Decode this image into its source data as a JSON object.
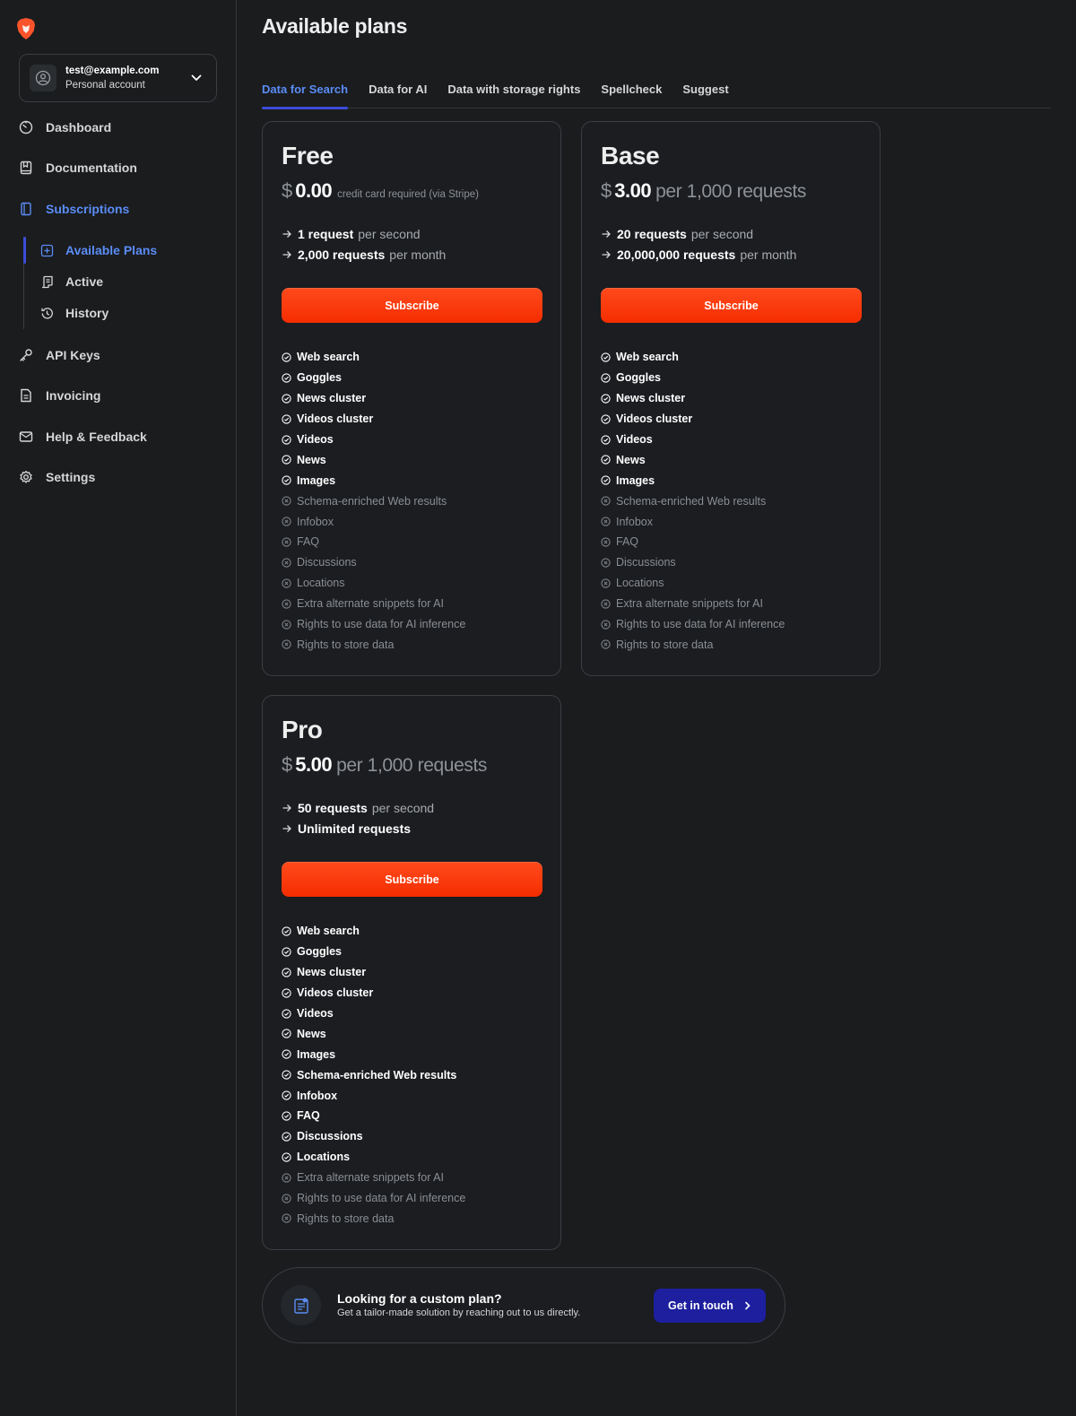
{
  "brand": {
    "wordmark": "",
    "accent": "#5b8cf5",
    "primary": "#f52d00",
    "cta": "#1d1f9e"
  },
  "account": {
    "email": "test@example.com",
    "type": "Personal account"
  },
  "nav": {
    "dashboard": "Dashboard",
    "documentation": "Documentation",
    "subscriptions": "Subscriptions",
    "available_plans": "Available Plans",
    "active": "Active",
    "history": "History",
    "api_keys": "API Keys",
    "invoicing": "Invoicing",
    "help": "Help & Feedback",
    "settings": "Settings"
  },
  "page": {
    "title": "Available plans"
  },
  "tabs": [
    "Data for Search",
    "Data for AI",
    "Data with storage rights",
    "Spellcheck",
    "Suggest"
  ],
  "plans": [
    {
      "name": "Free",
      "currency": "$",
      "amount": "0.00",
      "suffix": "credit card required (via Stripe)",
      "limit1_value": "1 request",
      "limit1_unit": "per second",
      "limit2_value": "2,000 requests",
      "limit2_unit": "per month",
      "button": "Subscribe",
      "features": [
        {
          "label": "Web search",
          "included": true
        },
        {
          "label": "Goggles",
          "included": true
        },
        {
          "label": "News cluster",
          "included": true
        },
        {
          "label": "Videos cluster",
          "included": true
        },
        {
          "label": "Videos",
          "included": true
        },
        {
          "label": "News",
          "included": true
        },
        {
          "label": "Images",
          "included": true
        },
        {
          "label": "Schema-enriched Web results",
          "included": false
        },
        {
          "label": "Infobox",
          "included": false
        },
        {
          "label": "FAQ",
          "included": false
        },
        {
          "label": "Discussions",
          "included": false
        },
        {
          "label": "Locations",
          "included": false
        },
        {
          "label": "Extra alternate snippets for AI",
          "included": false
        },
        {
          "label": "Rights to use data for AI inference",
          "included": false
        },
        {
          "label": "Rights to store data",
          "included": false
        }
      ]
    },
    {
      "name": "Base",
      "currency": "$",
      "amount": "3.00",
      "suffix": "per 1,000 requests",
      "limit1_value": "20 requests",
      "limit1_unit": "per second",
      "limit2_value": "20,000,000 requests",
      "limit2_unit": "per month",
      "button": "Subscribe",
      "features": [
        {
          "label": "Web search",
          "included": true
        },
        {
          "label": "Goggles",
          "included": true
        },
        {
          "label": "News cluster",
          "included": true
        },
        {
          "label": "Videos cluster",
          "included": true
        },
        {
          "label": "Videos",
          "included": true
        },
        {
          "label": "News",
          "included": true
        },
        {
          "label": "Images",
          "included": true
        },
        {
          "label": "Schema-enriched Web results",
          "included": false
        },
        {
          "label": "Infobox",
          "included": false
        },
        {
          "label": "FAQ",
          "included": false
        },
        {
          "label": "Discussions",
          "included": false
        },
        {
          "label": "Locations",
          "included": false
        },
        {
          "label": "Extra alternate snippets for AI",
          "included": false
        },
        {
          "label": "Rights to use data for AI inference",
          "included": false
        },
        {
          "label": "Rights to store data",
          "included": false
        }
      ]
    },
    {
      "name": "Pro",
      "currency": "$",
      "amount": "5.00",
      "suffix": "per 1,000 requests",
      "limit1_value": "50 requests",
      "limit1_unit": "per second",
      "limit2_value": "Unlimited requests",
      "limit2_unit": "",
      "button": "Subscribe",
      "features": [
        {
          "label": "Web search",
          "included": true
        },
        {
          "label": "Goggles",
          "included": true
        },
        {
          "label": "News cluster",
          "included": true
        },
        {
          "label": "Videos cluster",
          "included": true
        },
        {
          "label": "Videos",
          "included": true
        },
        {
          "label": "News",
          "included": true
        },
        {
          "label": "Images",
          "included": true
        },
        {
          "label": "Schema-enriched Web results",
          "included": true
        },
        {
          "label": "Infobox",
          "included": true
        },
        {
          "label": "FAQ",
          "included": true
        },
        {
          "label": "Discussions",
          "included": true
        },
        {
          "label": "Locations",
          "included": true
        },
        {
          "label": "Extra alternate snippets for AI",
          "included": false
        },
        {
          "label": "Rights to use data for AI inference",
          "included": false
        },
        {
          "label": "Rights to store data",
          "included": false
        }
      ]
    }
  ],
  "custom_plan": {
    "title": "Looking for a custom plan?",
    "subtitle": "Get a tailor-made solution by reaching out to us directly.",
    "button": "Get in touch"
  }
}
